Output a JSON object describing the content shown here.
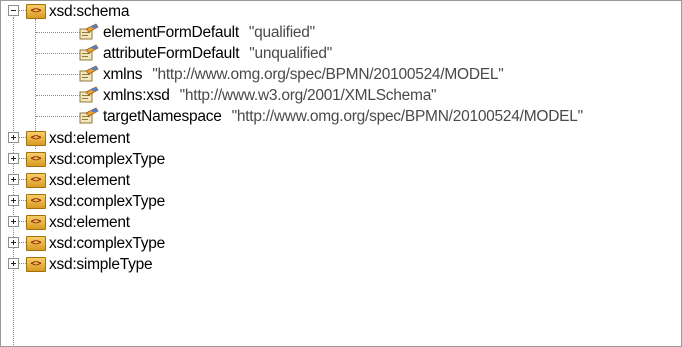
{
  "tree": {
    "root": {
      "label": "xsd:schema",
      "expanded": true
    },
    "attributes": [
      {
        "name": "elementFormDefault",
        "value": "\"qualified\""
      },
      {
        "name": "attributeFormDefault",
        "value": "\"unqualified\""
      },
      {
        "name": "xmlns",
        "value": "\"http://www.omg.org/spec/BPMN/20100524/MODEL\""
      },
      {
        "name": "xmlns:xsd",
        "value": "\"http://www.w3.org/2001/XMLSchema\""
      },
      {
        "name": "targetNamespace",
        "value": "\"http://www.omg.org/spec/BPMN/20100524/MODEL\""
      }
    ],
    "children": [
      {
        "label": "xsd:element",
        "expanded": false
      },
      {
        "label": "xsd:complexType",
        "expanded": false
      },
      {
        "label": "xsd:element",
        "expanded": false
      },
      {
        "label": "xsd:complexType",
        "expanded": false
      },
      {
        "label": "xsd:element",
        "expanded": false
      },
      {
        "label": "xsd:complexType",
        "expanded": false
      },
      {
        "label": "xsd:simpleType",
        "expanded": false
      }
    ],
    "icons": {
      "element": "xml-element-icon",
      "attribute": "xml-attribute-icon"
    },
    "colors": {
      "element_icon": "#e3ae3a",
      "attribute_value": "#4a4a4a",
      "tree_lines": "#8c8c8c"
    }
  }
}
